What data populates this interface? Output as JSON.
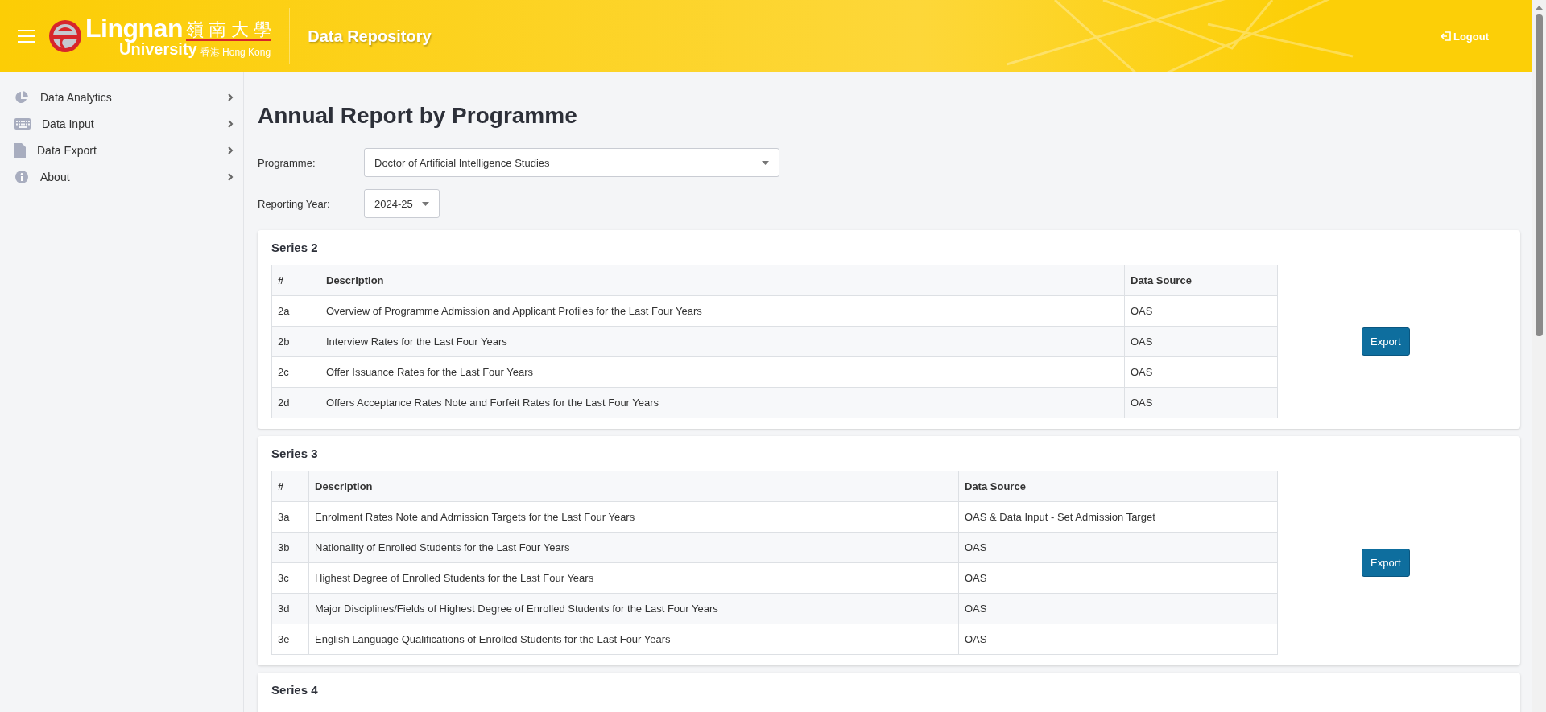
{
  "header": {
    "logo": {
      "name": "Lingnan",
      "chinese": "嶺 南 大 學",
      "sub": "University",
      "place": "香港 Hong Kong"
    },
    "app_title": "Data Repository",
    "logout": "Logout"
  },
  "sidebar": {
    "items": [
      {
        "label": "Data Analytics",
        "kind": "chart"
      },
      {
        "label": "Data Input",
        "kind": "keyboard"
      },
      {
        "label": "Data Export",
        "kind": "file"
      },
      {
        "label": "About",
        "kind": "info"
      }
    ]
  },
  "page_title": "Annual Report by Programme",
  "filters": [
    {
      "label": "Programme:",
      "value": "Doctor of Artificial Intelligence Studies",
      "kind": "wide"
    },
    {
      "label": "Reporting Year:",
      "value": "2024-25",
      "kind": "narrow"
    }
  ],
  "series": [
    {
      "title": "Series 2",
      "columns": [
        "#",
        "Description",
        "Data Source"
      ],
      "export": "Export",
      "rows": [
        [
          "2a",
          "Overview of Programme Admission and Applicant Profiles for the Last Four Years",
          "OAS"
        ],
        [
          "2b",
          "Interview Rates for the Last Four Years",
          "OAS"
        ],
        [
          "2c",
          "Offer Issuance Rates for the Last Four Years",
          "OAS"
        ],
        [
          "2d",
          "Offers Acceptance Rates Note and Forfeit Rates for the Last Four Years",
          "OAS"
        ]
      ]
    },
    {
      "title": "Series 3",
      "columns": [
        "#",
        "Description",
        "Data Source"
      ],
      "export": "Export",
      "rows": [
        [
          "3a",
          "Enrolment Rates Note and Admission Targets for the Last Four Years",
          "OAS & Data Input - Set Admission Target"
        ],
        [
          "3b",
          "Nationality of Enrolled Students for the Last Four Years",
          "OAS"
        ],
        [
          "3c",
          "Highest Degree of Enrolled Students for the Last Four Years",
          "OAS"
        ],
        [
          "3d",
          "Major Disciplines/Fields of Highest Degree of Enrolled Students for the Last Four Years",
          "OAS"
        ],
        [
          "3e",
          "English Language Qualifications of Enrolled Students for the Last Four Years",
          "OAS"
        ]
      ]
    },
    {
      "title": "Series 4"
    }
  ]
}
